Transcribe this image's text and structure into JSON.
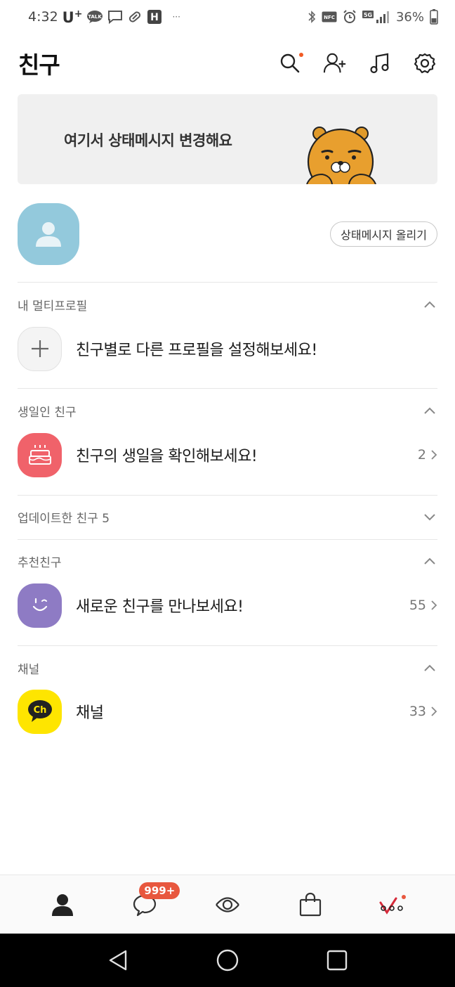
{
  "status_bar": {
    "time": "4:32",
    "carrier": "U",
    "carrier_plus": "+",
    "talk_badge": "TALK",
    "h_badge": "H",
    "dots": "···",
    "battery": "36%",
    "nfc": "NFC",
    "net": "5G"
  },
  "header": {
    "title": "친구",
    "icons": [
      "search-icon",
      "add-friend-icon",
      "music-icon",
      "settings-icon"
    ]
  },
  "banner": {
    "text": "여기서 상태메시지 변경해요"
  },
  "my_profile": {
    "status_button": "상태메시지 올리기"
  },
  "sections": {
    "multi_profile": {
      "title": "내 멀티프로필",
      "row_label": "친구별로 다른 프로필을 설정해보세요!"
    },
    "birthday": {
      "title": "생일인 친구",
      "row_label": "친구의 생일을 확인해보세요!",
      "count": "2"
    },
    "updated": {
      "title": "업데이트한 친구 5"
    },
    "recommended": {
      "title": "추천친구",
      "row_label": "새로운 친구를 만나보세요!",
      "count": "55"
    },
    "channel": {
      "title": "채널",
      "row_label": "채널",
      "count": "33",
      "icon_text": "Ch"
    }
  },
  "bottom_nav": {
    "chat_badge": "999+",
    "items": [
      "friends-icon",
      "chat-icon",
      "view-icon",
      "shopping-icon",
      "more-icon"
    ]
  },
  "colors": {
    "avatar": "#93c9dc",
    "birthday": "#f0626a",
    "recommend": "#8e7bc4",
    "channel": "#fee500",
    "badge": "#e8573e"
  }
}
